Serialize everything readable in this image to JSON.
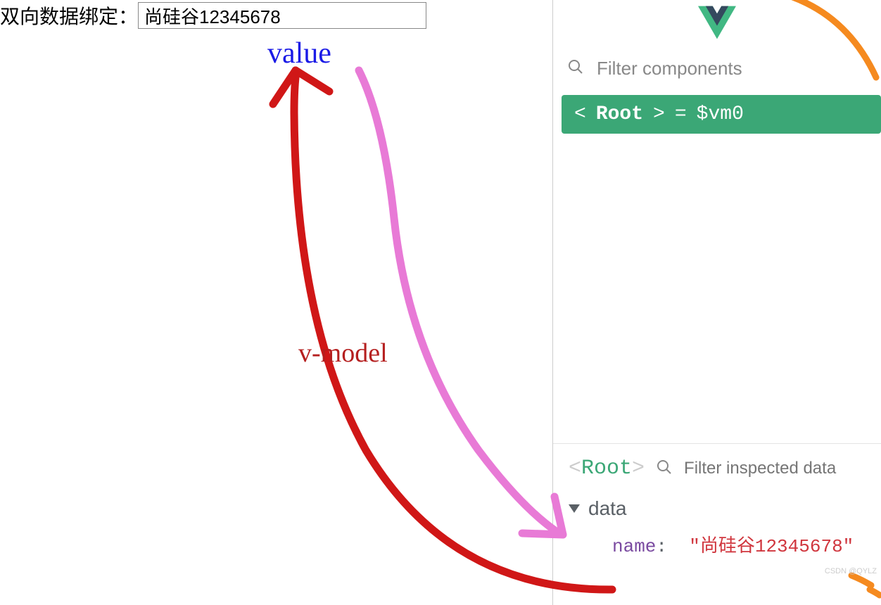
{
  "form": {
    "label": "双向数据绑定：",
    "value": "尚硅谷12345678"
  },
  "devtools": {
    "filter_components_placeholder": "Filter components",
    "root_badge": {
      "angle_open": "<",
      "name": "Root",
      "angle_close": ">",
      "equals": " = ",
      "vm": "$vm0"
    },
    "inspector": {
      "root_open": "<",
      "root_text": "Root",
      "root_close": ">",
      "filter_placeholder": "Filter inspected data",
      "data_label": "data",
      "property": {
        "key": "name",
        "colon": ":",
        "value": "\"尚硅谷12345678\""
      }
    }
  },
  "annotations": {
    "value_label": "value",
    "vmodel_label": "v-model"
  },
  "watermark": "CSDN @QYLZ"
}
